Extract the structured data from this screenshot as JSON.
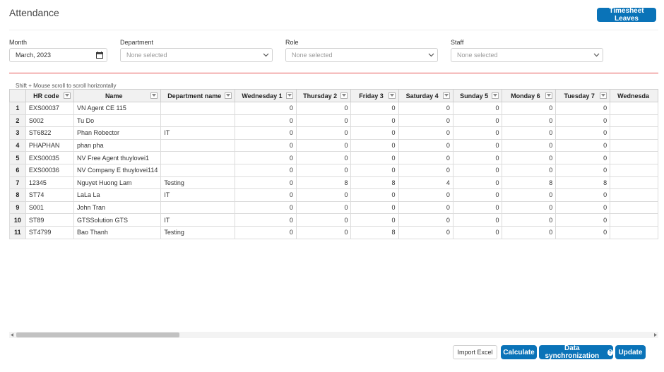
{
  "page": {
    "title": "Attendance"
  },
  "header": {
    "timesheet_button": "Timesheet Leaves"
  },
  "filters": {
    "month": {
      "label": "Month",
      "value": "March, 2023"
    },
    "department": {
      "label": "Department",
      "placeholder": "None selected"
    },
    "role": {
      "label": "Role",
      "placeholder": "None selected"
    },
    "staff": {
      "label": "Staff",
      "placeholder": "None selected"
    }
  },
  "hint": "Shift + Mouse scroll to scroll horizontally",
  "table": {
    "columns": [
      "HR code",
      "Name",
      "Department name",
      "Wednesday 1",
      "Thursday 2",
      "Friday 3",
      "Saturday 4",
      "Sunday 5",
      "Monday 6",
      "Tuesday 7",
      "Wednesda"
    ],
    "rows": [
      {
        "n": "1",
        "hr": "EXS00037",
        "name": "VN Agent CE 115",
        "dept": "",
        "days": [
          "0",
          "0",
          "0",
          "0",
          "0",
          "0",
          "0"
        ]
      },
      {
        "n": "2",
        "hr": "S002",
        "name": "Tu Do",
        "dept": "",
        "days": [
          "0",
          "0",
          "0",
          "0",
          "0",
          "0",
          "0"
        ]
      },
      {
        "n": "3",
        "hr": "ST6822",
        "name": "Phan Robector",
        "dept": "IT",
        "days": [
          "0",
          "0",
          "0",
          "0",
          "0",
          "0",
          "0"
        ]
      },
      {
        "n": "4",
        "hr": "PHAPHAN",
        "name": "phan pha",
        "dept": "",
        "days": [
          "0",
          "0",
          "0",
          "0",
          "0",
          "0",
          "0"
        ]
      },
      {
        "n": "5",
        "hr": "EXS00035",
        "name": "NV Free Agent thuylovei1",
        "dept": "",
        "days": [
          "0",
          "0",
          "0",
          "0",
          "0",
          "0",
          "0"
        ]
      },
      {
        "n": "6",
        "hr": "EXS00036",
        "name": "NV Company E thuylovei114",
        "dept": "",
        "days": [
          "0",
          "0",
          "0",
          "0",
          "0",
          "0",
          "0"
        ]
      },
      {
        "n": "7",
        "hr": "12345",
        "name": "Nguyet Huong Lam",
        "dept": "Testing",
        "days": [
          "0",
          "8",
          "8",
          "4",
          "0",
          "8",
          "8"
        ]
      },
      {
        "n": "8",
        "hr": "ST74",
        "name": "LaLa La",
        "dept": "IT",
        "days": [
          "0",
          "0",
          "0",
          "0",
          "0",
          "0",
          "0"
        ]
      },
      {
        "n": "9",
        "hr": "S001",
        "name": "John Tran",
        "dept": "",
        "days": [
          "0",
          "0",
          "0",
          "0",
          "0",
          "0",
          "0"
        ]
      },
      {
        "n": "10",
        "hr": "ST89",
        "name": "GTSSolution GTS",
        "dept": "IT",
        "days": [
          "0",
          "0",
          "0",
          "0",
          "0",
          "0",
          "0"
        ]
      },
      {
        "n": "11",
        "hr": "ST4799",
        "name": "Bao Thanh",
        "dept": "Testing",
        "days": [
          "0",
          "0",
          "8",
          "0",
          "0",
          "0",
          "0"
        ]
      }
    ]
  },
  "footer": {
    "import_excel": "Import Excel",
    "calculate": "Calculate",
    "data_sync": "Data synchronization",
    "data_sync_help": "?",
    "update": "Update"
  },
  "colors": {
    "primary": "#0a73b8",
    "divider_red": "#e55353",
    "header_bg": "#f1f1f1"
  },
  "icons": [
    "calendar-icon",
    "chevron-down-icon",
    "column-filter-icon",
    "help-icon",
    "scroll-left-icon",
    "scroll-right-icon"
  ]
}
